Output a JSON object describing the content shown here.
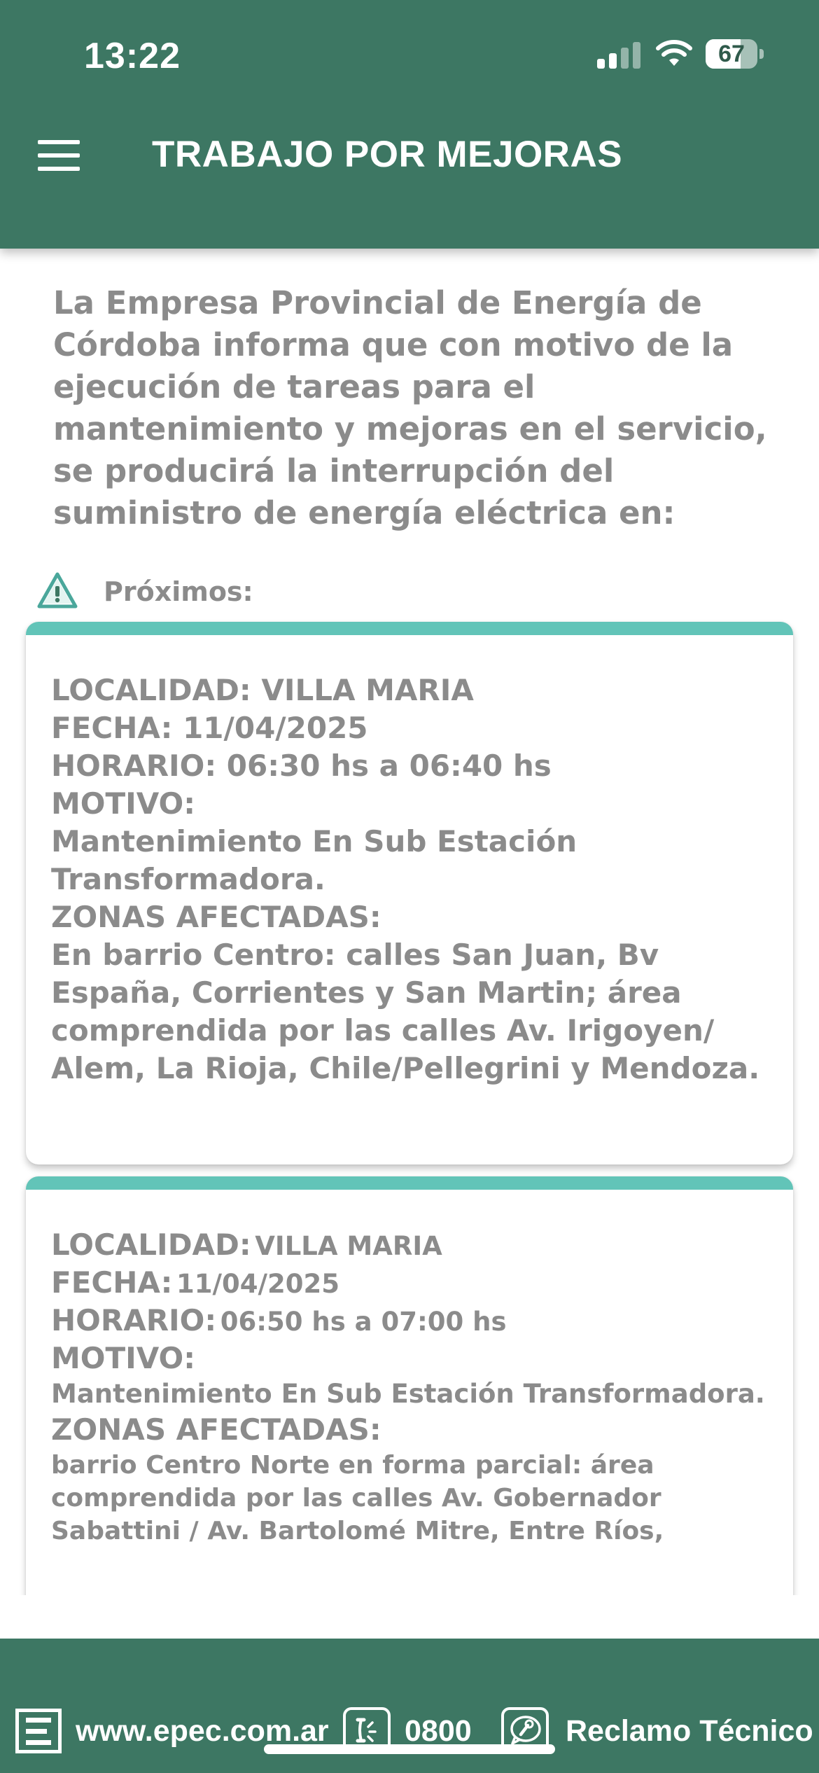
{
  "status_bar": {
    "time": "13:22",
    "battery_percent": "67",
    "battery_level": 0.67,
    "signal_bars_active": 2,
    "signal_bars_total": 4
  },
  "header": {
    "title": "TRABAJO POR MEJORAS",
    "menu_icon": "hamburger-menu-icon",
    "background_color": "#3d7763"
  },
  "intro": {
    "text": "La Empresa Provincial de Energía de Córdoba informa que con motivo de la ejecución de tareas para el mantenimiento y mejoras en el servicio, se producirá la interrupción del suministro de energía eléctrica en:"
  },
  "section": {
    "label": "Próximos:",
    "icon": "warning-triangle-icon",
    "accent_color": "#62c4b8"
  },
  "notices": [
    {
      "localidad_label": "LOCALIDAD:",
      "localidad": "VILLA MARIA",
      "fecha_label": "FECHA:",
      "fecha": "11/04/2025",
      "horario_label": "HORARIO:",
      "horario": "06:30 hs a 06:40 hs",
      "motivo_label": "MOTIVO:",
      "motivo": "Mantenimiento En Sub Estación Transformadora.",
      "zonas_label": "ZONAS AFECTADAS:",
      "zonas": "En barrio Centro: calles San Juan, Bv España, Corrientes y San Martin; área comprendida por las calles Av. Irigoyen/ Alem, La Rioja, Chile/Pellegrini y Mendoza."
    },
    {
      "localidad_label": "LOCALIDAD:",
      "localidad": "VILLA MARIA",
      "fecha_label": "FECHA:",
      "fecha": "11/04/2025",
      "horario_label": "HORARIO:",
      "horario": "06:50 hs a 07:00 hs",
      "motivo_label": "MOTIVO:",
      "motivo": "Mantenimiento En Sub Estación Transformadora.",
      "zonas_label": "ZONAS AFECTADAS:",
      "zonas": "barrio Centro Norte en forma parcial: área comprendida por las calles Av. Gobernador Sabattini / Av. Bartolomé Mitre, Entre Ríos,"
    }
  ],
  "footer": {
    "website": "www.epec.com.ar",
    "phone": "0800",
    "claim": "Reclamo Técnico",
    "logo_icon": "epec-logo-icon",
    "phone_icon": "phone-icon",
    "claim_icon": "wrench-bubble-icon"
  }
}
